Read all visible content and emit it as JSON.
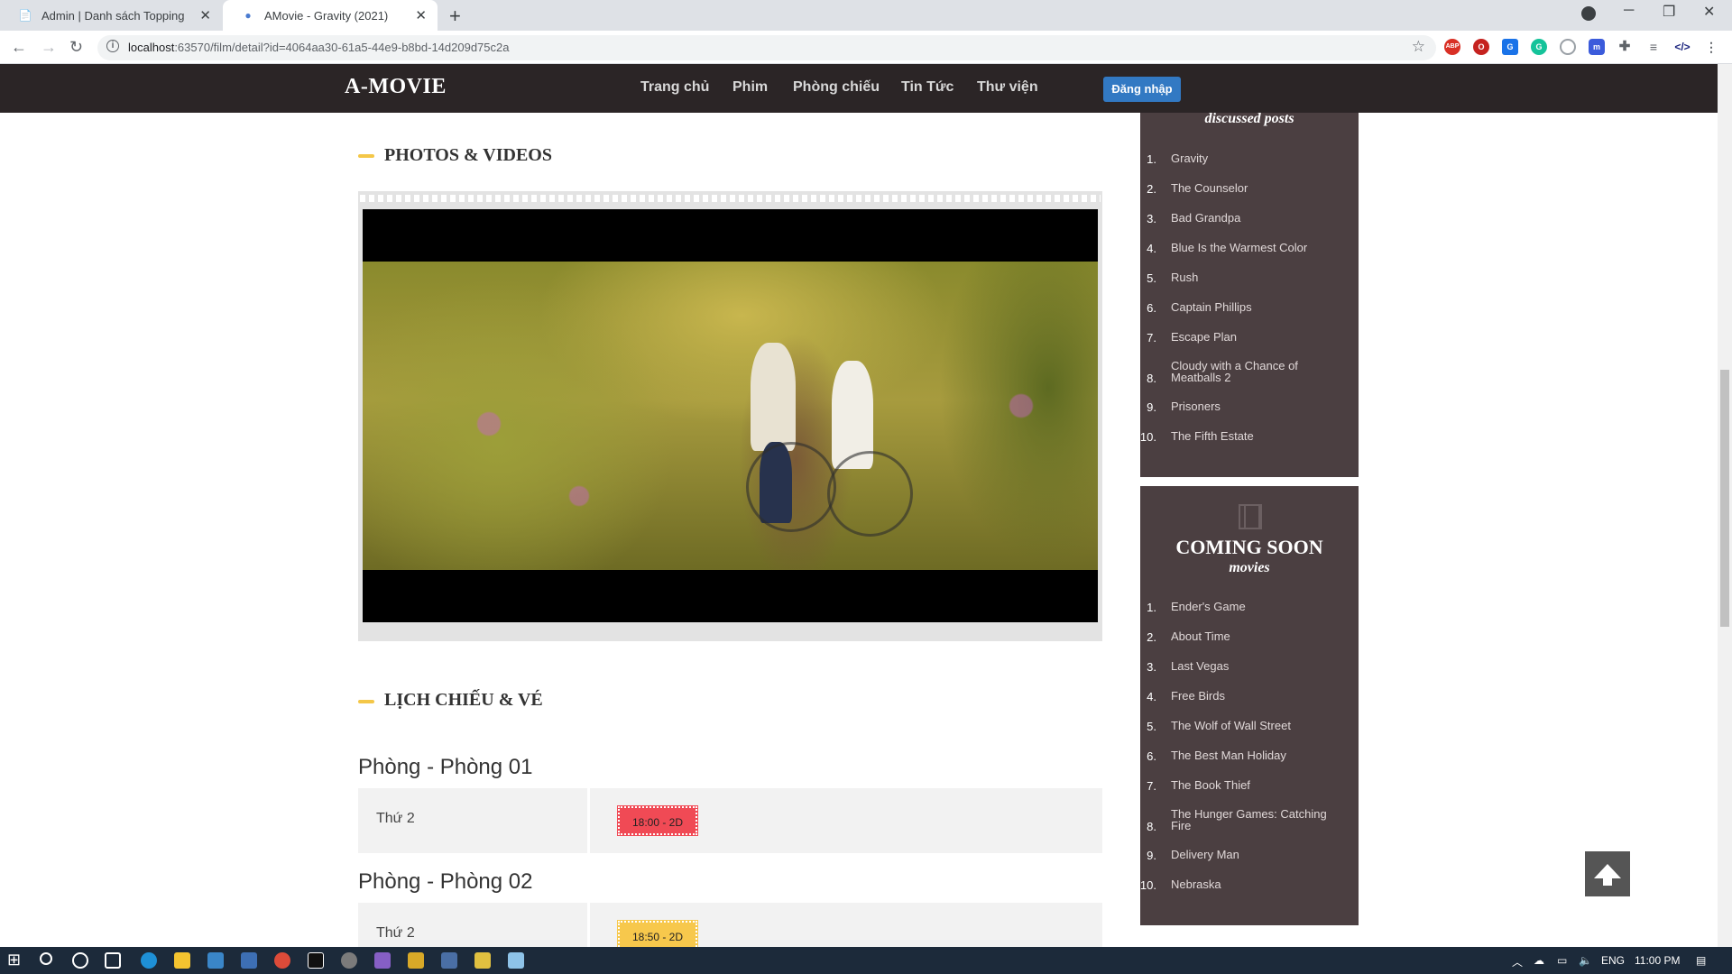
{
  "browser": {
    "tabs": [
      {
        "title": "Admin | Danh sách Topping",
        "active": false
      },
      {
        "title": "AMovie - Gravity (2021)",
        "active": true
      }
    ],
    "url_host": "localhost",
    "url_rest": ":63570/film/detail?id=4064aa30-61a5-44e9-b8bd-14d209d75c2a"
  },
  "site": {
    "logo": "A-MOVIE",
    "nav": [
      "Trang chủ",
      "Phim",
      "Phòng chiếu",
      "Tin Tức",
      "Thư viện"
    ],
    "login_label": "Đăng nhập"
  },
  "main": {
    "photos_heading": "PHOTOS & VIDEOS",
    "schedule_heading": "LỊCH CHIẾU & VÉ",
    "rooms": [
      {
        "title": "Phòng - Phòng 01",
        "day": "Thứ 2",
        "time": "18:00 - 2D",
        "color": "#f04a55"
      },
      {
        "title": "Phòng - Phòng 02",
        "day": "Thứ 2",
        "time": "18:50 - 2D",
        "color": "#f7c84c"
      }
    ]
  },
  "sidebar": {
    "discussed": {
      "subheading": "discussed posts",
      "items": [
        "Gravity",
        "The Counselor",
        "Bad Grandpa",
        "Blue Is the Warmest Color",
        "Rush",
        "Captain Phillips",
        "Escape Plan",
        "Cloudy with a Chance of Meatballs 2",
        "Prisoners",
        "The Fifth Estate"
      ]
    },
    "coming_soon": {
      "heading": "COMING SOON",
      "subheading": "movies",
      "items": [
        "Ender's Game",
        "About Time",
        "Last Vegas",
        "Free Birds",
        "The Wolf of Wall Street",
        "The Best Man Holiday",
        "The Book Thief",
        "The Hunger Games: Catching Fire",
        "Delivery Man",
        "Nebraska"
      ]
    }
  },
  "taskbar": {
    "language": "ENG",
    "time": "11:00 PM"
  }
}
